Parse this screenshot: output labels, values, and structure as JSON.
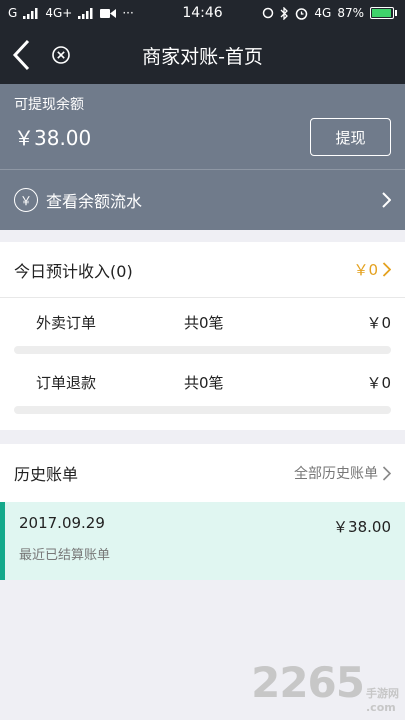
{
  "status_bar": {
    "carrier": "G",
    "network": "4G+",
    "time": "14:46",
    "network_right": "4G",
    "battery": "87%",
    "dots": "···"
  },
  "navbar": {
    "title": "商家对账-首页",
    "back_icon": "chevron-left-icon",
    "close_icon": "close-circle-icon"
  },
  "balance": {
    "label": "可提现余额",
    "amount": "￥38.00",
    "withdraw_label": "提现",
    "flow_label": "查看余额流水",
    "yen_symbol": "￥"
  },
  "today": {
    "title": "今日预计收入",
    "count": "(0)",
    "amount": "￥0",
    "rows": [
      {
        "name": "外卖订单",
        "count": "共0笔",
        "amount": "￥0"
      },
      {
        "name": "订单退款",
        "count": "共0笔",
        "amount": "￥0"
      }
    ]
  },
  "history": {
    "title": "历史账单",
    "all_label": "全部历史账单",
    "bill": {
      "date": "2017.09.29",
      "amount": "￥38.00",
      "desc": "最近已结算账单"
    }
  },
  "watermark": {
    "number": "2265",
    "cn": "手游网",
    "domain": ".com"
  },
  "colors": {
    "nav_bg": "#22262d",
    "balance_bg": "#707b8b",
    "accent_amount": "#e4a11f",
    "bill_bg": "#e0f6f1",
    "bill_border": "#14a98b"
  }
}
